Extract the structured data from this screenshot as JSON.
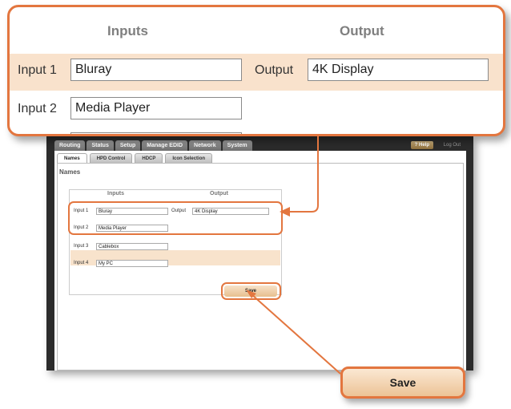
{
  "window": {
    "top_tabs": [
      "Routing",
      "Status",
      "Setup",
      "Manage EDID",
      "Network",
      "System"
    ],
    "help_label": "? Help",
    "logout_label": "Log Out",
    "sub_tabs": [
      "Names",
      "HPD Control",
      "HDCP",
      "Icon Selection"
    ],
    "section_title": "Names",
    "inputs_header": "Inputs",
    "output_header": "Output",
    "rows": [
      {
        "label": "Input 1",
        "value": "Bluray"
      },
      {
        "label": "Input 2",
        "value": "Media Player"
      },
      {
        "label": "Input 3",
        "value": "Cablebox"
      },
      {
        "label": "Input 4",
        "value": "My PC"
      }
    ],
    "output_label": "Output",
    "output_value": "4K Display",
    "save_label": "Save"
  },
  "magnified": {
    "inputs_header": "Inputs",
    "output_header": "Output",
    "input1_label": "Input 1",
    "input1_value": "Bluray",
    "output_label": "Output",
    "output_value": "4K Display",
    "input2_label": "Input 2",
    "input2_value": "Media Player"
  },
  "save_callout": {
    "label": "Save"
  },
  "colors": {
    "accent": "#e3763f",
    "highlight": "#f9e2cc"
  }
}
